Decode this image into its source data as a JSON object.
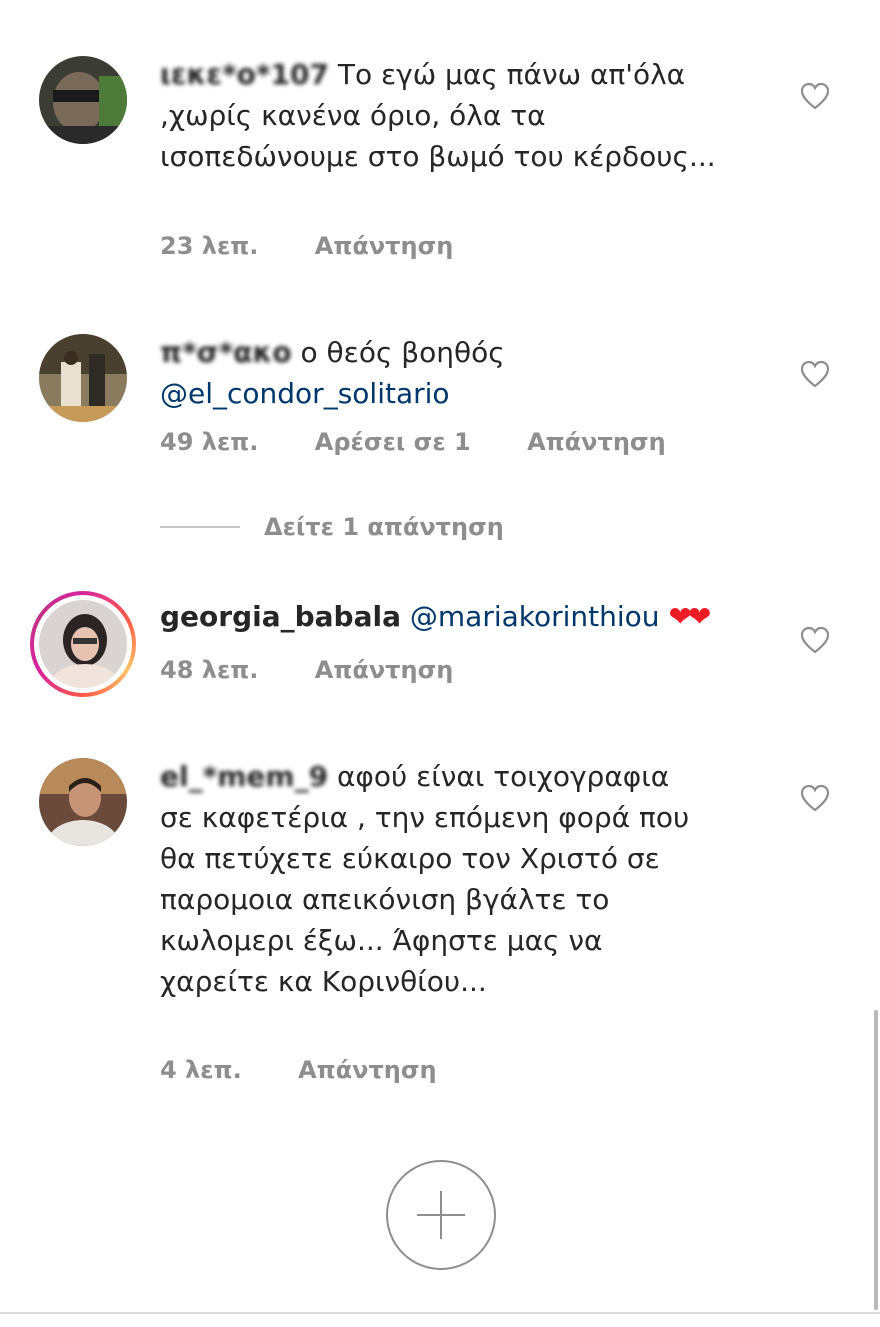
{
  "comments": [
    {
      "username": "ιεκε*ο*107",
      "text": "Το εγώ μας πάνω απ'όλα ,χωρίς κανένα όριο, όλα τα ισοπεδώνουμε στο βωμό του κέρδους...",
      "time": "23 λεπ.",
      "reply": "Απάντηση"
    },
    {
      "username": "π*σ*ακο",
      "text": "ο θεός βοηθός",
      "mention": "@el_condor_solitario",
      "time": "49 λεπ.",
      "likes": "Αρέσει σε 1",
      "reply": "Απάντηση"
    },
    {
      "username": "georgia_babala",
      "mention": "@mariakorinthiou",
      "emoji": "❤❤",
      "time": "48 λεπ.",
      "reply": "Απάντηση",
      "has_story_ring": true
    },
    {
      "username": "el_*mem_9",
      "text": "αφού είναι τοιχογραφια σε καφετέρια , την επόμενη φορά που θα πετύχετε εύκαιρο τον Χριστό σε παρομοια απεικόνιση βγάλτε το κωλομερι έξω... Άφηστε μας να χαρείτε κα Κορινθίου...",
      "time": "4 λεπ.",
      "reply": "Απάντηση"
    }
  ],
  "view_replies": "Δείτε 1 απάντηση",
  "icons": {
    "like": "heart-outline-icon",
    "add": "plus-circle-icon"
  },
  "colors": {
    "text": "#262626",
    "meta": "#8e8e8e",
    "mention": "#00376b",
    "emoji_heart": "#ed1c24"
  }
}
